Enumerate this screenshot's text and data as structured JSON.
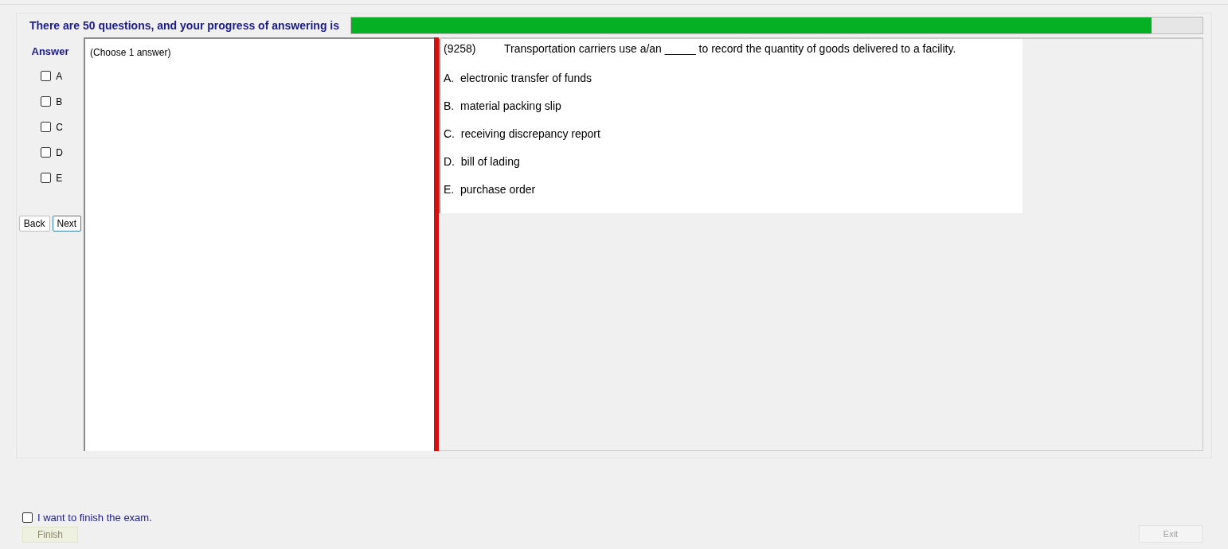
{
  "header": {
    "text": "There are 50 questions, and your progress of answering is",
    "progress": {
      "level": 0.94
    }
  },
  "answer_panel": {
    "title": "Answer",
    "options": [
      {
        "label": "A",
        "checked": false
      },
      {
        "label": "B",
        "checked": false
      },
      {
        "label": "C",
        "checked": false
      },
      {
        "label": "D",
        "checked": false
      },
      {
        "label": "E",
        "checked": false
      }
    ],
    "buttons": [
      {
        "label": "Back",
        "selected": false
      },
      {
        "label": "Next",
        "selected": true
      }
    ]
  },
  "instruction": "(Choose 1 answer)",
  "question": {
    "number": "(9258)",
    "text": "Transportation carriers use a/an _____ to record the quantity of goods delivered to a facility.",
    "choices": [
      "A.  electronic transfer of funds",
      "B.  material packing slip",
      "C.  receiving discrepancy report",
      "D.  bill of lading",
      "E.  purchase order"
    ]
  },
  "finish": {
    "label": "I want to finish the exam.",
    "checked": false,
    "button": {
      "label": "Finish",
      "disabled": true
    }
  },
  "exit_button": {
    "label": "Exit",
    "disabled": true
  }
}
